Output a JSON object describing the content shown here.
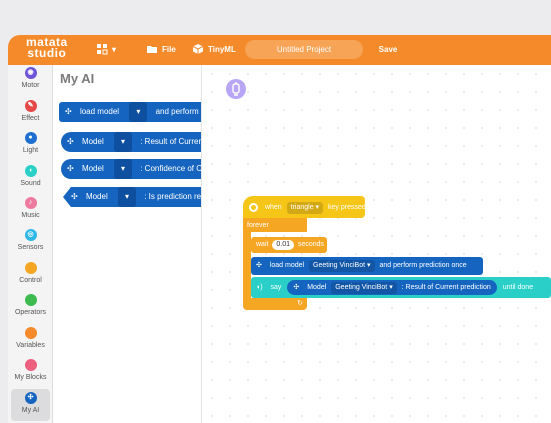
{
  "topbar": {
    "logo_line1": "matata",
    "logo_line2": "studio",
    "blocks_menu_arrow": "▾",
    "file_label": "File",
    "tinyml_label": "TinyML",
    "project_name": "Untitled Project",
    "save_label": "Save"
  },
  "sidebar": {
    "items": [
      {
        "label": "Motor",
        "color": "#6e54d9"
      },
      {
        "label": "Effect",
        "color": "#e54848"
      },
      {
        "label": "Light",
        "color": "#1f6fd0"
      },
      {
        "label": "Sound",
        "color": "#2ad0c8"
      },
      {
        "label": "Music",
        "color": "#ef7aa0"
      },
      {
        "label": "Sensors",
        "color": "#2db8e8"
      },
      {
        "label": "Control",
        "color": "#f5a623"
      },
      {
        "label": "Operators",
        "color": "#3dbb4f"
      },
      {
        "label": "Variables",
        "color": "#f48a2a"
      },
      {
        "label": "My Blocks",
        "color": "#ee5f7e"
      },
      {
        "label": "My AI",
        "color": "#1565c0"
      }
    ]
  },
  "flyout": {
    "title": "My AI",
    "blocks": [
      {
        "prefix": "load model",
        "suffix": "and perform p"
      },
      {
        "prefix": "Model",
        "suffix": ": Result of Curren"
      },
      {
        "prefix": "Model",
        "suffix": ": Confidence of C"
      },
      {
        "prefix": "Model",
        "suffix": ": Is prediction re"
      }
    ],
    "dropdown_arrow": "▾"
  },
  "script": {
    "when_label": "when",
    "key_option": "triangle ▾",
    "key_pressed_label": "key pressed",
    "forever_label": "forever",
    "wait_label": "wait",
    "wait_value": "0.01",
    "seconds_label": "seconds",
    "load_model_label": "load model",
    "model_option": "Geeting VinciBot ▾",
    "perform_label": "and perform prediction once",
    "say_label": "say",
    "model_label": "Model",
    "model_option2": "Geeting VinciBot ▾",
    "result_label": ": Result of Current prediction",
    "until_done_label": "until done",
    "loop_arrow": "↻"
  },
  "colors": {
    "accent": "#f48a2a",
    "ai_block": "#1565c0",
    "event": "#f5c518",
    "control": "#f5a623",
    "sound": "#2ad0c8"
  }
}
